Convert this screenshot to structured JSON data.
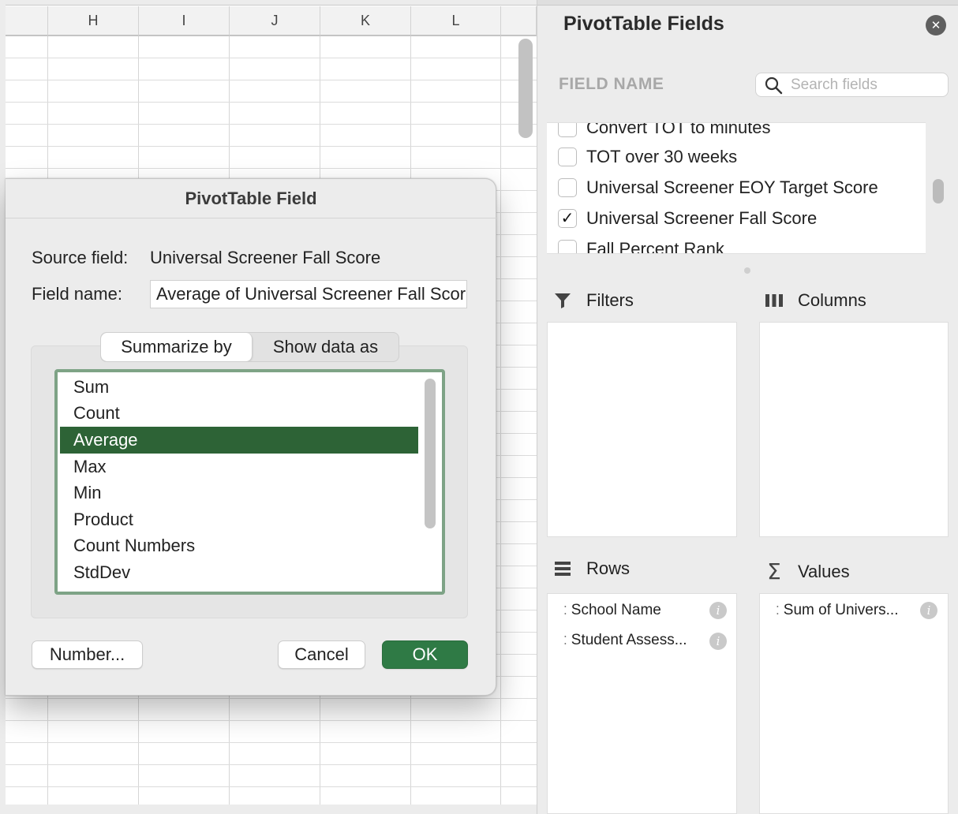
{
  "sheet": {
    "columns": [
      {
        "label": ""
      },
      {
        "label": "H"
      },
      {
        "label": "I"
      },
      {
        "label": "J"
      },
      {
        "label": "K"
      },
      {
        "label": "L"
      },
      {
        "label": ""
      }
    ]
  },
  "dialog": {
    "title": "PivotTable Field",
    "source_label": "Source field:",
    "source_value": "Universal Screener Fall Score",
    "field_name_label": "Field name:",
    "field_name_value": "Average of Universal Screener Fall Score",
    "tabs": [
      {
        "label": "Summarize by",
        "active": true
      },
      {
        "label": "Show data as",
        "active": false
      }
    ],
    "functions": [
      {
        "label": "Sum",
        "selected": false
      },
      {
        "label": "Count",
        "selected": false
      },
      {
        "label": "Average",
        "selected": true
      },
      {
        "label": "Max",
        "selected": false
      },
      {
        "label": "Min",
        "selected": false
      },
      {
        "label": "Product",
        "selected": false
      },
      {
        "label": "Count Numbers",
        "selected": false
      },
      {
        "label": "StdDev",
        "selected": false
      }
    ],
    "number_button": "Number...",
    "cancel_button": "Cancel",
    "ok_button": "OK",
    "accent_color": "#2d6336"
  },
  "pane": {
    "title": "PivotTable Fields",
    "field_name_header": "FIELD NAME",
    "search_placeholder": "Search fields",
    "fields": [
      {
        "label": "Convert TOT to minutes",
        "checked": false
      },
      {
        "label": "TOT over 30 weeks",
        "checked": false
      },
      {
        "label": "Universal Screener EOY Target Score",
        "checked": false
      },
      {
        "label": "Universal Screener Fall Score",
        "checked": true
      },
      {
        "label": "Fall Percent Rank",
        "checked": false
      }
    ],
    "areas": {
      "filters": {
        "label": "Filters",
        "items": []
      },
      "columns": {
        "label": "Columns",
        "items": []
      },
      "rows": {
        "label": "Rows",
        "items": [
          {
            "label": "School Name"
          },
          {
            "label": "Student Assess..."
          }
        ]
      },
      "values": {
        "label": "Values",
        "items": [
          {
            "label": "Sum of Univers..."
          }
        ]
      }
    }
  }
}
